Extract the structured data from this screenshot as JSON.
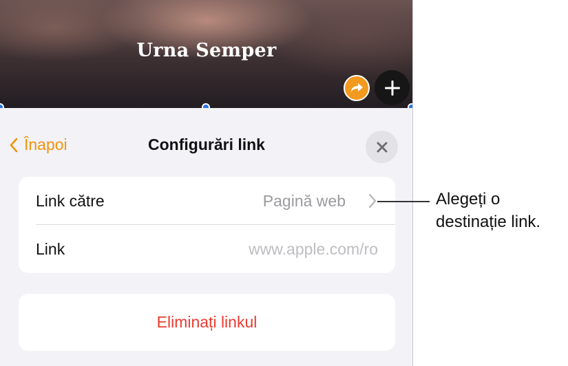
{
  "banner": {
    "title": "Urna Semper",
    "share_icon": "share-arrow-icon",
    "add_icon": "plus-icon",
    "accent": "#f29a1f"
  },
  "sheet": {
    "back_label": "Înapoi",
    "title": "Configurări link",
    "close_icon": "close-icon",
    "rows": [
      {
        "label": "Link către",
        "value": "Pagină web"
      },
      {
        "label": "Link",
        "placeholder": "www.apple.com/ro"
      }
    ],
    "delete_label": "Eliminați linkul"
  },
  "callout": {
    "line1": "Alegeți o",
    "line2": "destinație link."
  },
  "colors": {
    "accent_orange": "#f0940e",
    "destructive_red": "#eb3b30",
    "selection_blue": "#2a73e6"
  }
}
